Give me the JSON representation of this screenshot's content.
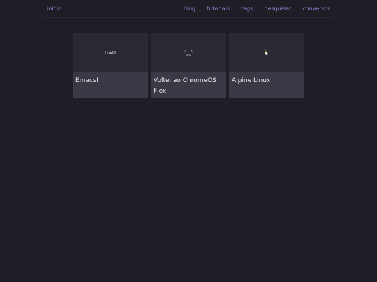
{
  "nav": {
    "home": "inicio",
    "links": [
      "blog",
      "tutoriais",
      "tags",
      "pesquisar",
      "conversor"
    ]
  },
  "posts": [
    {
      "thumb": "UwU",
      "title": "Emacs!"
    },
    {
      "thumb": "ó⁔ò",
      "title": "Voltei ao ChromeOS Flex"
    },
    {
      "thumb": "🐧",
      "title": "Alpine Linux"
    }
  ]
}
